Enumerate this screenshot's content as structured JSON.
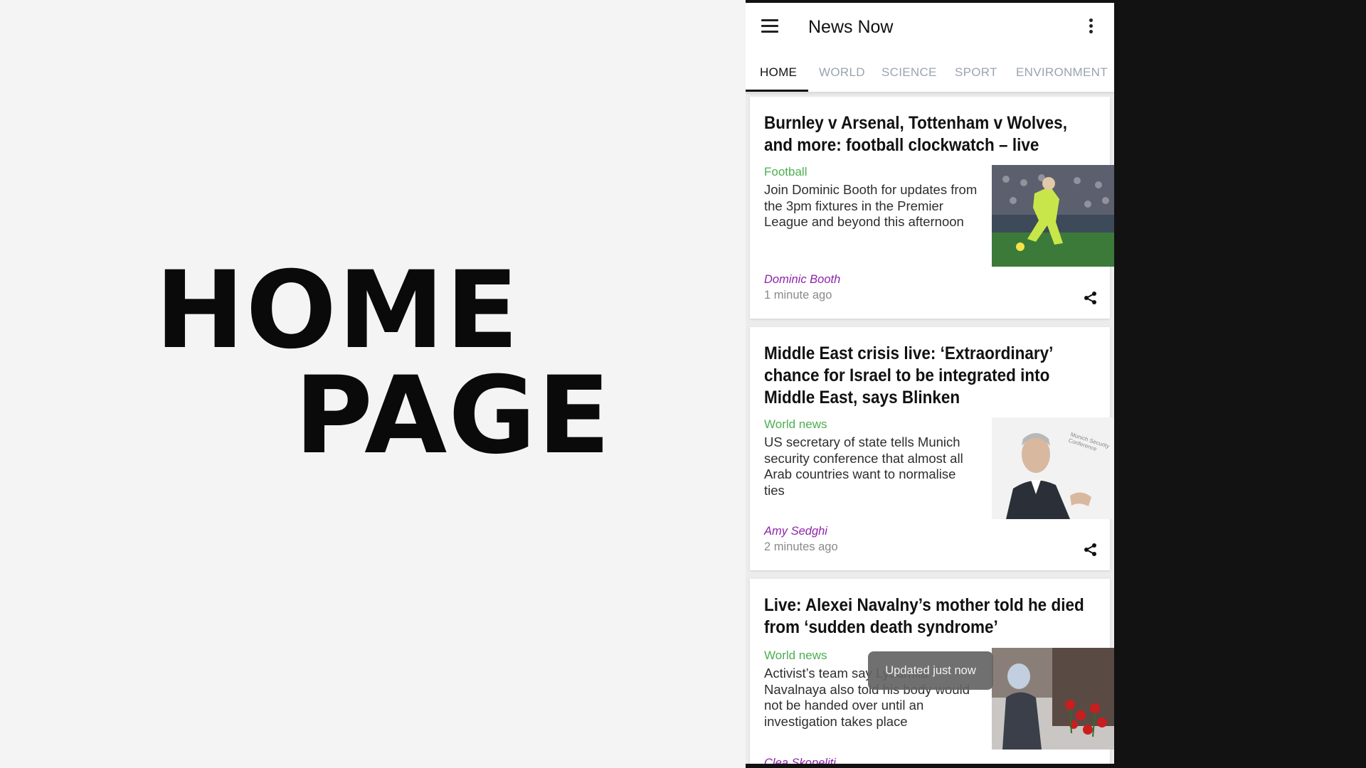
{
  "hero": {
    "line1": "HOME",
    "line2": "PAGE"
  },
  "app": {
    "title": "News Now",
    "menu_icon": "hamburger-menu-icon",
    "more_icon": "vertical-more-icon"
  },
  "tabs": [
    {
      "label": "HOME",
      "active": true
    },
    {
      "label": "WORLD",
      "active": false
    },
    {
      "label": "SCIENCE",
      "active": false
    },
    {
      "label": "SPORT",
      "active": false
    },
    {
      "label": "ENVIRONMENT",
      "active": false
    }
  ],
  "articles": [
    {
      "headline": "Burnley v Arsenal, Tottenham v Wolves, and more: football clockwatch – live",
      "section": "Football",
      "summary": "Join Dominic Booth for updates from the 3pm fixtures in the Premier League and beyond this afternoon",
      "author": "Dominic Booth",
      "time": "1 minute ago",
      "thumb_icon": "football-player-photo"
    },
    {
      "headline": "Middle East crisis live: ‘Extraordinary’ chance for Israel to be integrated into Middle East, says Blinken",
      "section": "World news",
      "summary": "US secretary of state tells Munich security conference that almost all Arab countries want to normalise ties",
      "author": "Amy Sedghi",
      "time": "2 minutes ago",
      "thumb_icon": "speaker-photo",
      "thumb_caption": "Munich Security Conference"
    },
    {
      "headline": "Live: Alexei Navalny’s mother told he died from ‘sudden death syndrome’",
      "section": "World news",
      "summary": "Activist’s team say Lyudmila Navalnaya also told his body would not be handed over until an investigation takes place",
      "author": "Clea Skopeliti",
      "thumb_icon": "memorial-flowers-photo"
    }
  ],
  "toast": "Updated just now",
  "colors": {
    "section": "#4caf50",
    "author": "#8e24aa",
    "tab_inactive": "#9aa4b0"
  }
}
